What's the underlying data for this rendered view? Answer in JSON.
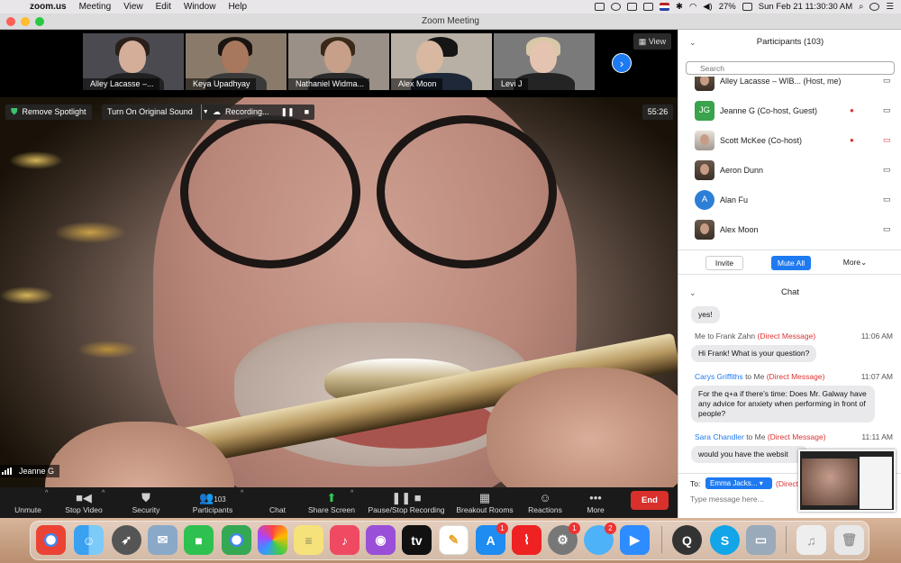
{
  "menubar": {
    "app": "zoom.us",
    "items": [
      "Meeting",
      "View",
      "Edit",
      "Window",
      "Help"
    ],
    "battery": "27%",
    "datetime": "Sun Feb 21  11:30:30 AM"
  },
  "window": {
    "title": "Zoom Meeting"
  },
  "gallery": {
    "tiles": [
      {
        "name": "Alley Lacasse –..."
      },
      {
        "name": "Keya Upadhyay"
      },
      {
        "name": "Nathaniel Widma..."
      },
      {
        "name": "Alex Moon"
      },
      {
        "name": "Levi J"
      }
    ],
    "view_label": "View"
  },
  "video_controls": {
    "remove_spotlight": "Remove Spotlight",
    "original_sound": "Turn On Original Sound",
    "recording": "Recording...",
    "timer": "55:26",
    "speaker": "Jeanne G"
  },
  "toolbar": {
    "unmute": "Unmute",
    "stop_video": "Stop Video",
    "security": "Security",
    "participants": "Participants",
    "participants_count": "103",
    "chat": "Chat",
    "share_screen": "Share Screen",
    "pause_recording": "Pause/Stop Recording",
    "breakout": "Breakout Rooms",
    "reactions": "Reactions",
    "more": "More",
    "end": "End"
  },
  "participants": {
    "header": "Participants (103)",
    "search_placeholder": "Search",
    "list": [
      {
        "name": "Alley Lacasse – WIB... (Host, me)",
        "initials": ""
      },
      {
        "name": "Jeanne G (Co-host, Guest)",
        "initials": "JG"
      },
      {
        "name": "Scott McKee (Co-host)",
        "initials": ""
      },
      {
        "name": "Aeron Dunn",
        "initials": ""
      },
      {
        "name": "Alan Fu",
        "initials": "A"
      },
      {
        "name": "Alex Moon",
        "initials": ""
      }
    ],
    "invite": "Invite",
    "mute_all": "Mute All",
    "more": "More"
  },
  "chat": {
    "header": "Chat",
    "messages": [
      {
        "text": "yes!"
      },
      {
        "sender": "Me",
        "to": "to Frank Zahn",
        "dm": "(Direct Message)",
        "time": "11:06 AM",
        "text": "Hi Frank! What is your question?"
      },
      {
        "sender": "Carys Griffiths",
        "to": "to Me",
        "dm": "(Direct Message)",
        "time": "11:07 AM",
        "text": "For the q+a if there’s time: Does Mr. Galway have any advice for anxiety when performing in front of people?"
      },
      {
        "sender": "Sara Chandler",
        "to": "to Me",
        "dm": "(Direct Message)",
        "time": "11:11 AM",
        "text": "would you have the websit"
      }
    ],
    "to_label": "To:",
    "to_value": "Emma Jacks...",
    "to_dm": "(Direct",
    "input_placeholder": "Type message here..."
  },
  "dock": {
    "badges": [
      "1",
      "1",
      "2"
    ]
  },
  "colors": {
    "accent": "#1e7af0",
    "end": "#d9302c",
    "direct_message": "#dd3333"
  }
}
